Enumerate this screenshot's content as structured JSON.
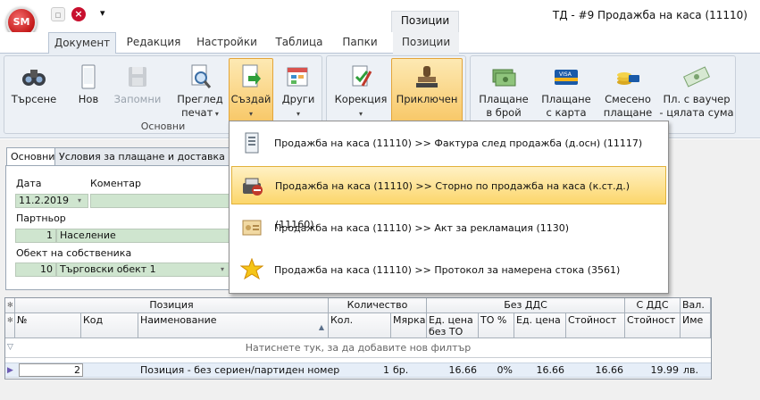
{
  "app": {
    "title": "ТД - #9 Продажба на каса (11110)",
    "logo": "SM",
    "context_tab": "Позиции",
    "qat_menu_arrow": "▾"
  },
  "tabs": [
    "Документ",
    "Редакция",
    "Настройки",
    "Таблица",
    "Папки",
    "Позиции"
  ],
  "ribbon": {
    "search": "Търсене",
    "new": "Нов",
    "save": "Запомни",
    "preview": "Преглед\nпечат",
    "create": "Създай",
    "other": "Други",
    "group_main": "Основни",
    "correction": "Корекция",
    "close": "Приключен",
    "pay_cash": "Плащане\nв брой",
    "pay_card": "Плащане\nс карта",
    "pay_mixed": "Смесено\nплащане",
    "pay_voucher": "Пл. с ваучер\n- цялата сума"
  },
  "form": {
    "tab_main": "Основни",
    "tab_terms": "Условия за плащане и доставка",
    "date_label": "Дата",
    "date_value": "11.2.2019",
    "comment_label": "Коментар",
    "partner_label": "Партньор",
    "partner_code": "1",
    "partner_name": "Население",
    "object_label": "Обект на собственика",
    "object_code": "10",
    "object_name": "Търговски обект 1"
  },
  "menu": [
    {
      "label": "Продажба на каса (11110) >> Фактура след продажба (д.осн) (11117)",
      "icon": "invoice-icon"
    },
    {
      "label": "Продажба на каса (11110) >> Сторно по продажба на каса (к.ст.д.) (11160)",
      "icon": "storno-icon"
    },
    {
      "label": "Продажба на каса (11110) >> Акт за рекламация (1130)",
      "icon": "complaint-icon"
    },
    {
      "label": "Продажба на каса (11110) >> Протокол за намерена стока (3561)",
      "icon": "found-goods-icon"
    }
  ],
  "grid": {
    "band_position": "Позиция",
    "band_quantity": "Количество",
    "band_novat": "Без ДДС",
    "band_vat": "С ДДС",
    "band_cur": "Вал.",
    "col_no": "№",
    "col_code": "Код",
    "col_name": "Наименование",
    "col_qty": "Кол.",
    "col_unit": "Мярка",
    "col_price_noto": "Ед. цена\nбез ТО",
    "col_to": "ТО %",
    "col_price": "Ед. цена",
    "col_value": "Стойност",
    "col_value_vat": "Стойност",
    "col_cur_name": "Име",
    "filter_text": "Натиснете тук, за да добавите нов филтър",
    "row": {
      "no": "2",
      "code": "",
      "name": "Позиция - без сериен/партиден номер",
      "qty": "1",
      "unit": "бр.",
      "price_noto": "16.66",
      "to": "0%",
      "price": "16.66",
      "value": "16.66",
      "value_vat": "19.99",
      "cur": "лв."
    }
  },
  "colors": {
    "accent": "#f8c868",
    "field": "#cfe5cf"
  }
}
